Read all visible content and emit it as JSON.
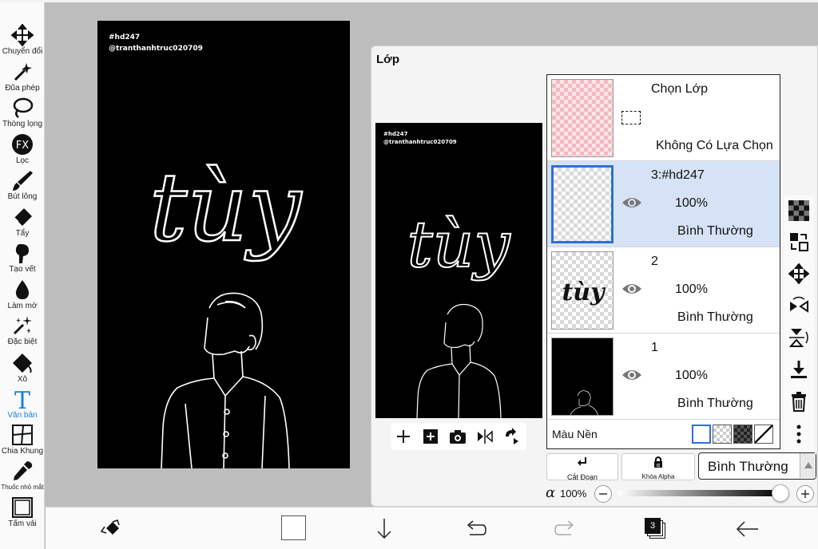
{
  "toolbar": {
    "tools": [
      {
        "label": "Chuyển đổi",
        "icon": "move-icon"
      },
      {
        "label": "Đũa phép",
        "icon": "magic-wand-icon"
      },
      {
        "label": "Thòng lọng",
        "icon": "lasso-icon"
      },
      {
        "label": "Lọc",
        "icon": "fx-filter-icon"
      },
      {
        "label": "Bút lông",
        "icon": "brush-icon"
      },
      {
        "label": "Tẩy",
        "icon": "eraser-icon"
      },
      {
        "label": "Tạo vết",
        "icon": "smudge-icon"
      },
      {
        "label": "Làm mờ",
        "icon": "blur-drop-icon"
      },
      {
        "label": "Đặc biệt",
        "icon": "special-sparkle-icon"
      },
      {
        "label": "Xô",
        "icon": "bucket-icon"
      },
      {
        "label": "Văn bản",
        "icon": "text-icon"
      },
      {
        "label": "Chia Khung",
        "icon": "frame-divider-icon"
      },
      {
        "label": "Thuốc nhỏ mắt",
        "icon": "eyedropper-icon"
      },
      {
        "label": "Tấm vải",
        "icon": "canvas-icon"
      }
    ],
    "active_index": 10,
    "active_color": "#1a7ee0"
  },
  "artwork": {
    "tag": "#hd247",
    "handle": "@tranthanhtruc020709",
    "lettering": "tùy"
  },
  "layer_panel": {
    "title": "Lớp",
    "selection_row": {
      "title": "Chọn Lớp",
      "status": "Không Có Lựa Chọn"
    },
    "layers": [
      {
        "name": "3:#hd247",
        "opacity": "100%",
        "blend": "Bình Thường",
        "selected": true
      },
      {
        "name": "2",
        "opacity": "100%",
        "blend": "Bình Thường",
        "selected": false
      },
      {
        "name": "1",
        "opacity": "100%",
        "blend": "Bình Thường",
        "selected": false
      }
    ],
    "layer2_thumb_text": "tùy",
    "background": {
      "label": "Màu Nền"
    },
    "clip_button": "Cắt Đoạn",
    "alpha_lock_button": "Khóa Alpha",
    "blend_mode": "Bình Thường",
    "alpha": {
      "symbol": "α",
      "value": "100%",
      "fraction": 1.0
    }
  },
  "bottombar": {
    "layer_count": "3"
  },
  "colors": {
    "selected_row": "#d6e3f7",
    "selection_border": "#2f6fd6",
    "canvas_bg": "#bdbdbd"
  }
}
